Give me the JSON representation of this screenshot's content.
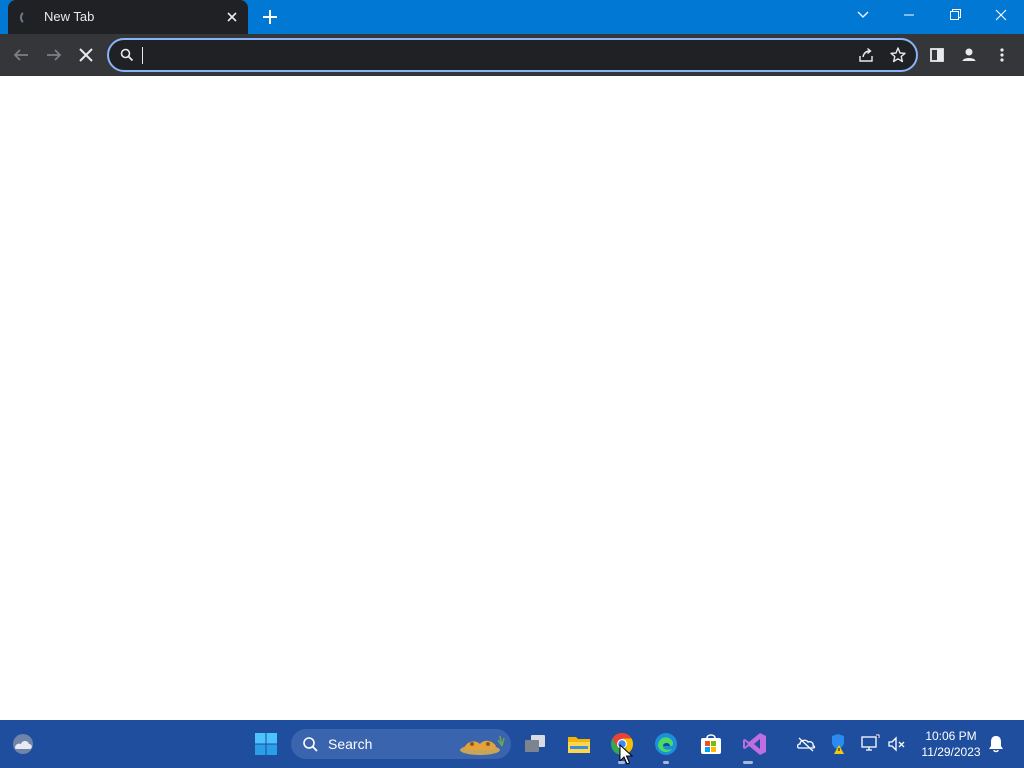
{
  "tab": {
    "title": "New Tab"
  },
  "omnibox": {
    "value": "",
    "placeholder": ""
  },
  "taskbar": {
    "search_label": "Search"
  },
  "clock": {
    "time": "10:06 PM",
    "date": "11/29/2023"
  },
  "colors": {
    "titlebar": "#0078d4",
    "toolbar": "#35363a",
    "omnibox_border": "#8ab4f8",
    "taskbar": "#1f4e9e"
  }
}
